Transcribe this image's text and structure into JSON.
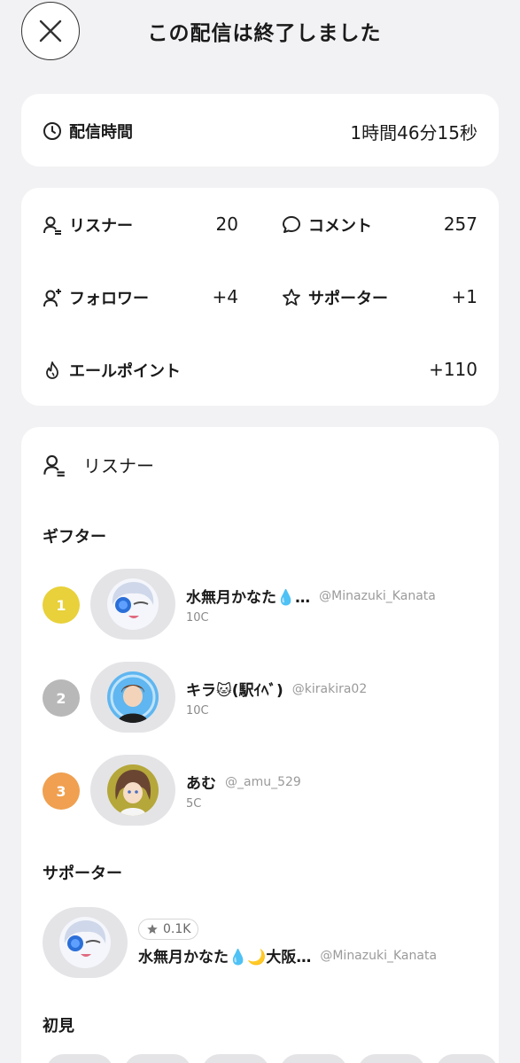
{
  "header": {
    "title": "この配信は終了しました"
  },
  "duration": {
    "label": "配信時間",
    "value": "1時間46分15秒"
  },
  "stats": {
    "listeners": {
      "label": "リスナー",
      "value": "20"
    },
    "comments": {
      "label": "コメント",
      "value": "257"
    },
    "followers": {
      "label": "フォロワー",
      "value": "+4"
    },
    "supporters": {
      "label": "サポーター",
      "value": "+1"
    },
    "yell_points": {
      "label": "エールポイント",
      "value": "+110"
    }
  },
  "listener_panel": {
    "title": "リスナー",
    "gifters_label": "ギフター",
    "gifters": [
      {
        "rank": "1",
        "name": "水無月かなた💧…",
        "handle": "@Minazuki_Kanata",
        "coins": "10C"
      },
      {
        "rank": "2",
        "name": "キラ🐱(駅ｲﾍﾞ)",
        "handle": "@kirakira02",
        "coins": "10C"
      },
      {
        "rank": "3",
        "name": "あむ",
        "handle": "@_amu_529",
        "coins": "5C"
      }
    ],
    "supporters_label": "サポーター",
    "supporter": {
      "badge": "0.1K",
      "name": "水無月かなた💧🌙大阪…",
      "handle": "@Minazuki_Kanata"
    },
    "first_time_label": "初見"
  },
  "colors": {
    "gold": "#e8d13a",
    "silver": "#b8b8b8",
    "bronze": "#f0a050"
  }
}
